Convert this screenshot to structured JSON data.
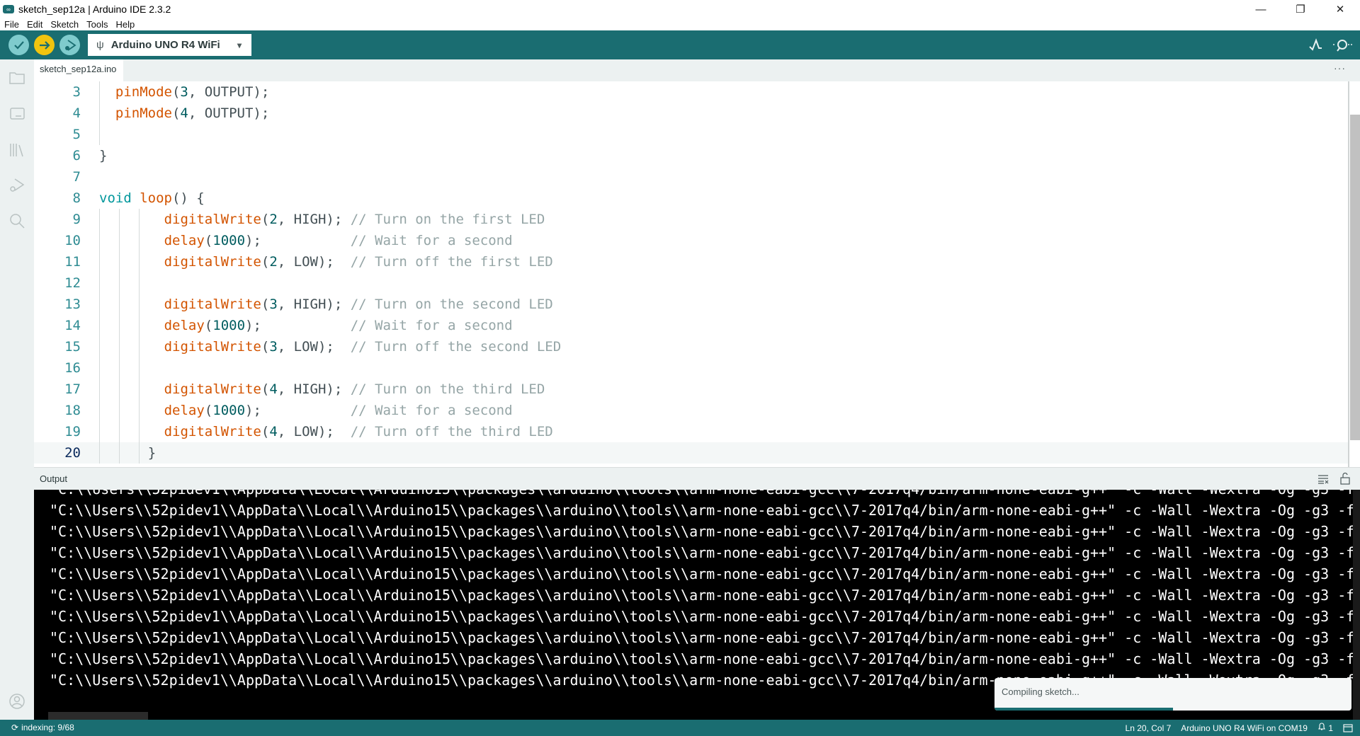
{
  "window": {
    "title": "sketch_sep12a | Arduino IDE 2.3.2",
    "logo": "∞",
    "controls": {
      "minimize": "—",
      "restore": "❐",
      "close": "✕"
    }
  },
  "menu": [
    "File",
    "Edit",
    "Sketch",
    "Tools",
    "Help"
  ],
  "toolbar": {
    "verify_icon": "✓",
    "upload_icon": "→",
    "debug_icon": "▷",
    "usb_icon": "ψ",
    "board": "Arduino UNO R4 WiFi",
    "dropdown_icon": "▾",
    "serial_plotter_icon": "√",
    "serial_monitor_icon": "⊙"
  },
  "tabs": [
    {
      "label": "sketch_sep12a.ino"
    }
  ],
  "tab_more": "···",
  "editor": {
    "lines": [
      {
        "n": "3",
        "indent": 1,
        "tokens": [
          [
            "fn",
            "pinMode"
          ],
          [
            "p",
            "("
          ],
          [
            "num",
            "3"
          ],
          [
            "p",
            ", OUTPUT);"
          ]
        ]
      },
      {
        "n": "4",
        "indent": 1,
        "tokens": [
          [
            "fn",
            "pinMode"
          ],
          [
            "p",
            "("
          ],
          [
            "num",
            "4"
          ],
          [
            "p",
            ", OUTPUT);"
          ]
        ]
      },
      {
        "n": "5",
        "indent": 1,
        "tokens": []
      },
      {
        "n": "6",
        "indent": 0,
        "tokens": [
          [
            "p",
            "}"
          ]
        ]
      },
      {
        "n": "7",
        "indent": 0,
        "tokens": []
      },
      {
        "n": "8",
        "indent": 0,
        "tokens": [
          [
            "kw",
            "void"
          ],
          [
            "p",
            " "
          ],
          [
            "fn",
            "loop"
          ],
          [
            "p",
            "() {"
          ]
        ]
      },
      {
        "n": "9",
        "indent": 4,
        "tokens": [
          [
            "fn",
            "digitalWrite"
          ],
          [
            "p",
            "("
          ],
          [
            "num",
            "2"
          ],
          [
            "p",
            ", HIGH); "
          ],
          [
            "cm",
            "// Turn on the first LED"
          ]
        ]
      },
      {
        "n": "10",
        "indent": 4,
        "tokens": [
          [
            "fn",
            "delay"
          ],
          [
            "p",
            "("
          ],
          [
            "num",
            "1000"
          ],
          [
            "p",
            ");           "
          ],
          [
            "cm",
            "// Wait for a second"
          ]
        ]
      },
      {
        "n": "11",
        "indent": 4,
        "tokens": [
          [
            "fn",
            "digitalWrite"
          ],
          [
            "p",
            "("
          ],
          [
            "num",
            "2"
          ],
          [
            "p",
            ", LOW);  "
          ],
          [
            "cm",
            "// Turn off the first LED"
          ]
        ]
      },
      {
        "n": "12",
        "indent": 4,
        "tokens": []
      },
      {
        "n": "13",
        "indent": 4,
        "tokens": [
          [
            "fn",
            "digitalWrite"
          ],
          [
            "p",
            "("
          ],
          [
            "num",
            "3"
          ],
          [
            "p",
            ", HIGH); "
          ],
          [
            "cm",
            "// Turn on the second LED"
          ]
        ]
      },
      {
        "n": "14",
        "indent": 4,
        "tokens": [
          [
            "fn",
            "delay"
          ],
          [
            "p",
            "("
          ],
          [
            "num",
            "1000"
          ],
          [
            "p",
            ");           "
          ],
          [
            "cm",
            "// Wait for a second"
          ]
        ]
      },
      {
        "n": "15",
        "indent": 4,
        "tokens": [
          [
            "fn",
            "digitalWrite"
          ],
          [
            "p",
            "("
          ],
          [
            "num",
            "3"
          ],
          [
            "p",
            ", LOW);  "
          ],
          [
            "cm",
            "// Turn off the second LED"
          ]
        ]
      },
      {
        "n": "16",
        "indent": 4,
        "tokens": []
      },
      {
        "n": "17",
        "indent": 4,
        "tokens": [
          [
            "fn",
            "digitalWrite"
          ],
          [
            "p",
            "("
          ],
          [
            "num",
            "4"
          ],
          [
            "p",
            ", HIGH); "
          ],
          [
            "cm",
            "// Turn on the third LED"
          ]
        ]
      },
      {
        "n": "18",
        "indent": 4,
        "tokens": [
          [
            "fn",
            "delay"
          ],
          [
            "p",
            "("
          ],
          [
            "num",
            "1000"
          ],
          [
            "p",
            ");           "
          ],
          [
            "cm",
            "// Wait for a second"
          ]
        ]
      },
      {
        "n": "19",
        "indent": 4,
        "tokens": [
          [
            "fn",
            "digitalWrite"
          ],
          [
            "p",
            "("
          ],
          [
            "num",
            "4"
          ],
          [
            "p",
            ", LOW);  "
          ],
          [
            "cm",
            "// Turn off the third LED"
          ]
        ]
      },
      {
        "n": "20",
        "indent": 3,
        "current": true,
        "tokens": [
          [
            "p",
            "}"
          ]
        ]
      }
    ]
  },
  "output": {
    "label": "Output",
    "clear_icon": "≡",
    "lock_icon": "🔓",
    "line": "\"C:\\\\Users\\\\52pidev1\\\\AppData\\\\Local\\\\Arduino15\\\\packages\\\\arduino\\\\tools\\\\arm-none-eabi-gcc\\\\7-2017q4/bin/arm-none-eabi-g++\" -c -Wall -Wextra -Og -g3 -f",
    "line_count": 10
  },
  "notification": {
    "message": "Compiling sketch...",
    "progress": 0.5
  },
  "status": {
    "indexing_icon": "⟳",
    "indexing": "indexing: 9/68",
    "cursor": "Ln 20, Col 7",
    "board_port": "Arduino UNO R4 WiFi on COM19",
    "notifications_icon": "🔔",
    "notifications_count": "1",
    "panel_icon": "▭"
  }
}
